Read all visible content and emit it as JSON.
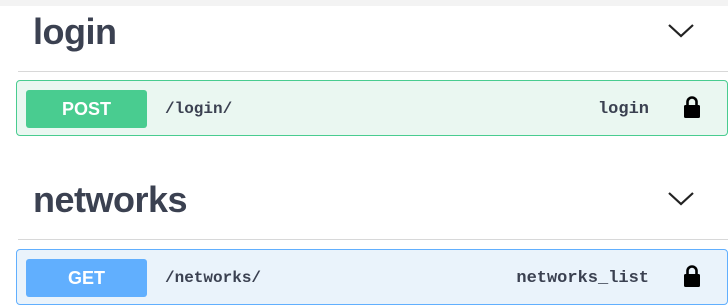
{
  "sections": [
    {
      "title": "login",
      "icon": "chevron-down-icon",
      "operation": {
        "method": "POST",
        "path": "/login/",
        "operation_id": "login",
        "icon": "lock-icon",
        "color": "#49cc90"
      }
    },
    {
      "title": "networks",
      "icon": "chevron-down-icon",
      "operation": {
        "method": "GET",
        "path": "/networks/",
        "operation_id": "networks_list",
        "icon": "lock-icon",
        "color": "#61affe"
      }
    }
  ]
}
